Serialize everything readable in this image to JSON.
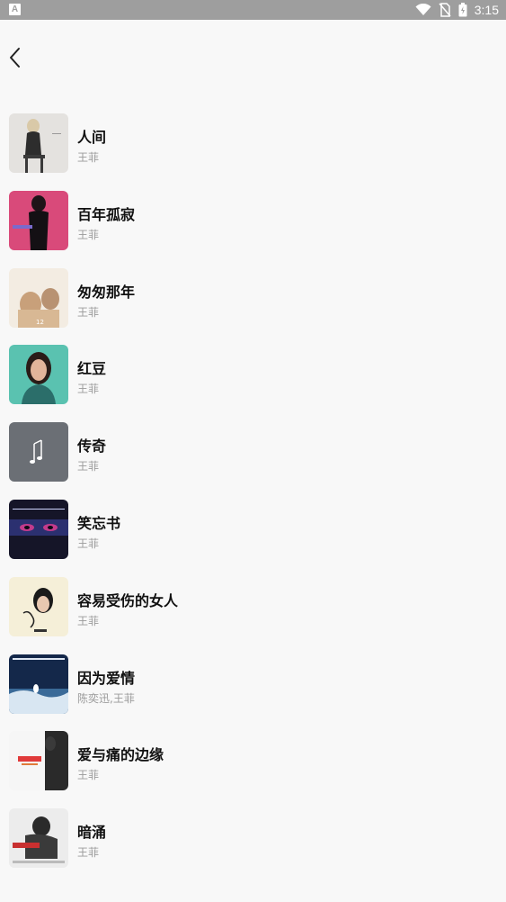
{
  "status_bar": {
    "app_indicator": "A",
    "time": "3:15",
    "icons": [
      "wifi-icon",
      "no-sim-icon",
      "battery-icon"
    ]
  },
  "header": {
    "back_icon": "chevron-left-icon"
  },
  "songs": [
    {
      "title": "人间",
      "artist": "王菲"
    },
    {
      "title": "百年孤寂",
      "artist": "王菲"
    },
    {
      "title": "匆匆那年",
      "artist": "王菲"
    },
    {
      "title": "红豆",
      "artist": "王菲"
    },
    {
      "title": "传奇",
      "artist": "王菲"
    },
    {
      "title": "笑忘书",
      "artist": "王菲"
    },
    {
      "title": "容易受伤的女人",
      "artist": "王菲"
    },
    {
      "title": "因为爱情",
      "artist": "陈奕迅,王菲"
    },
    {
      "title": "爱与痛的边缘",
      "artist": "王菲"
    },
    {
      "title": "暗涌",
      "artist": "王菲"
    }
  ]
}
